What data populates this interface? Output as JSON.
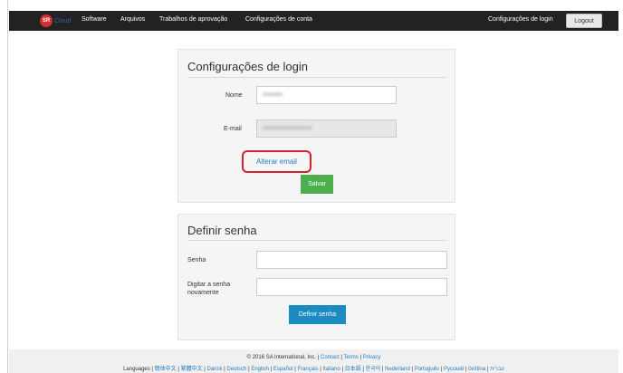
{
  "navbar": {
    "brand_logo_text": "SR",
    "brand_text": "Cloud",
    "items": [
      "Software",
      "Arquivos",
      "Trabalhos de aprovação",
      "Configurações de conta"
    ],
    "login_settings": "Configurações de login",
    "logout": "Logout"
  },
  "login_panel": {
    "title": "Configurações de login",
    "name_label": "Nome",
    "email_label": "E-mail",
    "change_email_link": "Alterar email",
    "save_button": "Salvar"
  },
  "password_panel": {
    "title": "Definir senha",
    "password_label": "Senha",
    "confirm_label": "Digitar a senha novamente",
    "submit_button": "Definir senha"
  },
  "footer": {
    "copyright": "© 2016 SA International, Inc. |",
    "contact": "Contact",
    "sep1": "|",
    "terms": "Terms",
    "sep2": "|",
    "privacy": "Privacy",
    "languages_label": "Languages |",
    "languages": [
      "簡体中文",
      "繁體中文",
      "Dansk",
      "Deutsch",
      "English",
      "Español",
      "Français",
      "Italiano",
      "日本語",
      "한국어",
      "Nederland",
      "Português",
      "Русский",
      "čeština",
      "עברית"
    ]
  },
  "colors": {
    "navbar_bg": "#222222",
    "link": "#1f7fc2",
    "save_button": "#4cae4c",
    "submit_button": "#1b8bc0",
    "highlight": "#d0232b"
  }
}
